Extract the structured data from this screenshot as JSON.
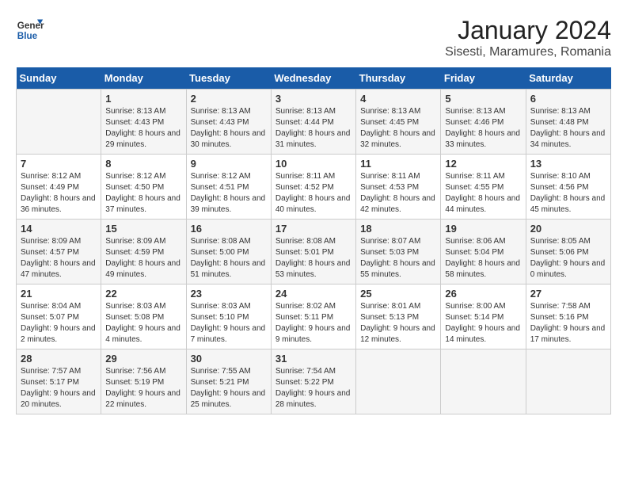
{
  "logo": {
    "text_general": "General",
    "text_blue": "Blue"
  },
  "title": "January 2024",
  "location": "Sisesti, Maramures, Romania",
  "days_of_week": [
    "Sunday",
    "Monday",
    "Tuesday",
    "Wednesday",
    "Thursday",
    "Friday",
    "Saturday"
  ],
  "weeks": [
    [
      {
        "day": "",
        "sunrise": "",
        "sunset": "",
        "daylight": ""
      },
      {
        "day": "1",
        "sunrise": "Sunrise: 8:13 AM",
        "sunset": "Sunset: 4:43 PM",
        "daylight": "Daylight: 8 hours and 29 minutes."
      },
      {
        "day": "2",
        "sunrise": "Sunrise: 8:13 AM",
        "sunset": "Sunset: 4:43 PM",
        "daylight": "Daylight: 8 hours and 30 minutes."
      },
      {
        "day": "3",
        "sunrise": "Sunrise: 8:13 AM",
        "sunset": "Sunset: 4:44 PM",
        "daylight": "Daylight: 8 hours and 31 minutes."
      },
      {
        "day": "4",
        "sunrise": "Sunrise: 8:13 AM",
        "sunset": "Sunset: 4:45 PM",
        "daylight": "Daylight: 8 hours and 32 minutes."
      },
      {
        "day": "5",
        "sunrise": "Sunrise: 8:13 AM",
        "sunset": "Sunset: 4:46 PM",
        "daylight": "Daylight: 8 hours and 33 minutes."
      },
      {
        "day": "6",
        "sunrise": "Sunrise: 8:13 AM",
        "sunset": "Sunset: 4:48 PM",
        "daylight": "Daylight: 8 hours and 34 minutes."
      }
    ],
    [
      {
        "day": "7",
        "sunrise": "Sunrise: 8:12 AM",
        "sunset": "Sunset: 4:49 PM",
        "daylight": "Daylight: 8 hours and 36 minutes."
      },
      {
        "day": "8",
        "sunrise": "Sunrise: 8:12 AM",
        "sunset": "Sunset: 4:50 PM",
        "daylight": "Daylight: 8 hours and 37 minutes."
      },
      {
        "day": "9",
        "sunrise": "Sunrise: 8:12 AM",
        "sunset": "Sunset: 4:51 PM",
        "daylight": "Daylight: 8 hours and 39 minutes."
      },
      {
        "day": "10",
        "sunrise": "Sunrise: 8:11 AM",
        "sunset": "Sunset: 4:52 PM",
        "daylight": "Daylight: 8 hours and 40 minutes."
      },
      {
        "day": "11",
        "sunrise": "Sunrise: 8:11 AM",
        "sunset": "Sunset: 4:53 PM",
        "daylight": "Daylight: 8 hours and 42 minutes."
      },
      {
        "day": "12",
        "sunrise": "Sunrise: 8:11 AM",
        "sunset": "Sunset: 4:55 PM",
        "daylight": "Daylight: 8 hours and 44 minutes."
      },
      {
        "day": "13",
        "sunrise": "Sunrise: 8:10 AM",
        "sunset": "Sunset: 4:56 PM",
        "daylight": "Daylight: 8 hours and 45 minutes."
      }
    ],
    [
      {
        "day": "14",
        "sunrise": "Sunrise: 8:09 AM",
        "sunset": "Sunset: 4:57 PM",
        "daylight": "Daylight: 8 hours and 47 minutes."
      },
      {
        "day": "15",
        "sunrise": "Sunrise: 8:09 AM",
        "sunset": "Sunset: 4:59 PM",
        "daylight": "Daylight: 8 hours and 49 minutes."
      },
      {
        "day": "16",
        "sunrise": "Sunrise: 8:08 AM",
        "sunset": "Sunset: 5:00 PM",
        "daylight": "Daylight: 8 hours and 51 minutes."
      },
      {
        "day": "17",
        "sunrise": "Sunrise: 8:08 AM",
        "sunset": "Sunset: 5:01 PM",
        "daylight": "Daylight: 8 hours and 53 minutes."
      },
      {
        "day": "18",
        "sunrise": "Sunrise: 8:07 AM",
        "sunset": "Sunset: 5:03 PM",
        "daylight": "Daylight: 8 hours and 55 minutes."
      },
      {
        "day": "19",
        "sunrise": "Sunrise: 8:06 AM",
        "sunset": "Sunset: 5:04 PM",
        "daylight": "Daylight: 8 hours and 58 minutes."
      },
      {
        "day": "20",
        "sunrise": "Sunrise: 8:05 AM",
        "sunset": "Sunset: 5:06 PM",
        "daylight": "Daylight: 9 hours and 0 minutes."
      }
    ],
    [
      {
        "day": "21",
        "sunrise": "Sunrise: 8:04 AM",
        "sunset": "Sunset: 5:07 PM",
        "daylight": "Daylight: 9 hours and 2 minutes."
      },
      {
        "day": "22",
        "sunrise": "Sunrise: 8:03 AM",
        "sunset": "Sunset: 5:08 PM",
        "daylight": "Daylight: 9 hours and 4 minutes."
      },
      {
        "day": "23",
        "sunrise": "Sunrise: 8:03 AM",
        "sunset": "Sunset: 5:10 PM",
        "daylight": "Daylight: 9 hours and 7 minutes."
      },
      {
        "day": "24",
        "sunrise": "Sunrise: 8:02 AM",
        "sunset": "Sunset: 5:11 PM",
        "daylight": "Daylight: 9 hours and 9 minutes."
      },
      {
        "day": "25",
        "sunrise": "Sunrise: 8:01 AM",
        "sunset": "Sunset: 5:13 PM",
        "daylight": "Daylight: 9 hours and 12 minutes."
      },
      {
        "day": "26",
        "sunrise": "Sunrise: 8:00 AM",
        "sunset": "Sunset: 5:14 PM",
        "daylight": "Daylight: 9 hours and 14 minutes."
      },
      {
        "day": "27",
        "sunrise": "Sunrise: 7:58 AM",
        "sunset": "Sunset: 5:16 PM",
        "daylight": "Daylight: 9 hours and 17 minutes."
      }
    ],
    [
      {
        "day": "28",
        "sunrise": "Sunrise: 7:57 AM",
        "sunset": "Sunset: 5:17 PM",
        "daylight": "Daylight: 9 hours and 20 minutes."
      },
      {
        "day": "29",
        "sunrise": "Sunrise: 7:56 AM",
        "sunset": "Sunset: 5:19 PM",
        "daylight": "Daylight: 9 hours and 22 minutes."
      },
      {
        "day": "30",
        "sunrise": "Sunrise: 7:55 AM",
        "sunset": "Sunset: 5:21 PM",
        "daylight": "Daylight: 9 hours and 25 minutes."
      },
      {
        "day": "31",
        "sunrise": "Sunrise: 7:54 AM",
        "sunset": "Sunset: 5:22 PM",
        "daylight": "Daylight: 9 hours and 28 minutes."
      },
      {
        "day": "",
        "sunrise": "",
        "sunset": "",
        "daylight": ""
      },
      {
        "day": "",
        "sunrise": "",
        "sunset": "",
        "daylight": ""
      },
      {
        "day": "",
        "sunrise": "",
        "sunset": "",
        "daylight": ""
      }
    ]
  ]
}
